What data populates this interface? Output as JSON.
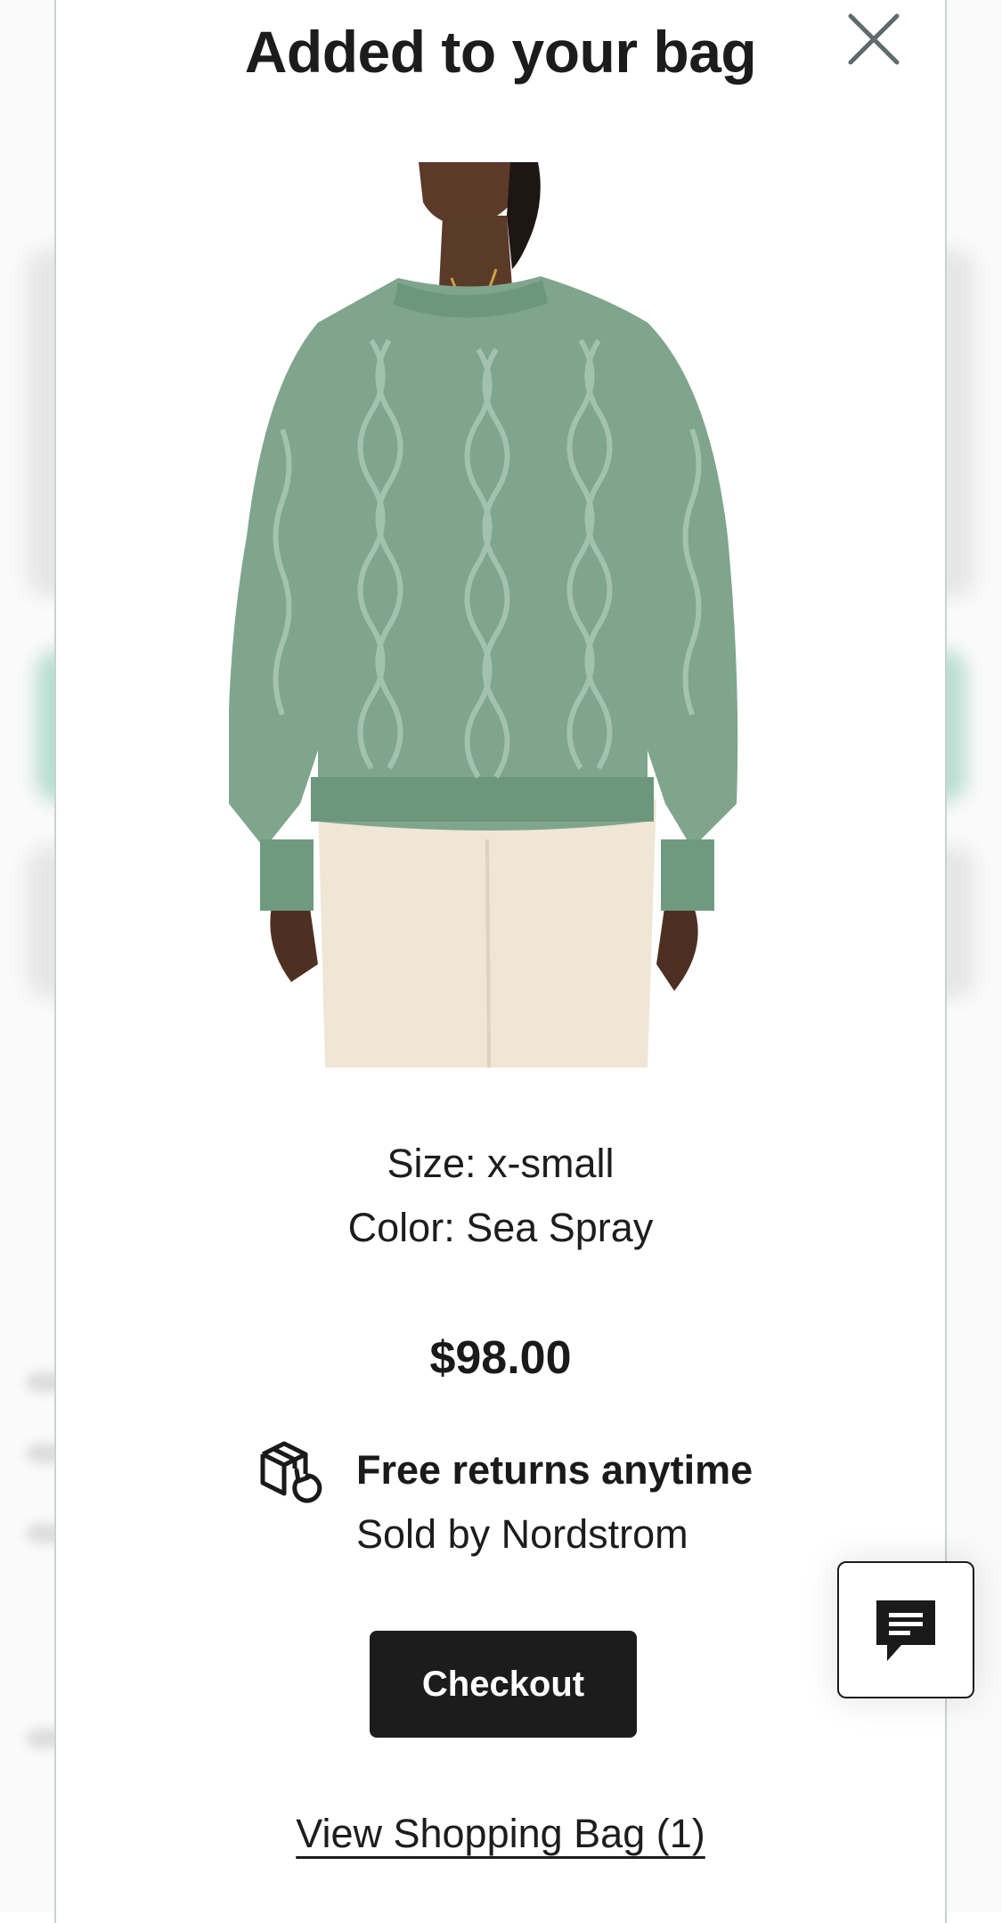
{
  "modal": {
    "title": "Added to your bag",
    "close_icon": "close-icon"
  },
  "product": {
    "image_alt": "Green cable-knit sweater",
    "size_line": "Size: x-small",
    "color_line": "Color: Sea Spray",
    "price": "$98.00"
  },
  "returns": {
    "icon": "box-return-icon",
    "title": "Free returns anytime",
    "sold_by": "Sold by Nordstrom"
  },
  "actions": {
    "checkout_label": "Checkout",
    "view_bag_label": "View Shopping Bag (1)"
  },
  "chat": {
    "icon": "chat-bubble-icon"
  },
  "colors": {
    "sweater": "#7fa58d",
    "pants": "#efe6d6",
    "button": "#1c1c1c",
    "background_accent": "#b9ddd2"
  }
}
